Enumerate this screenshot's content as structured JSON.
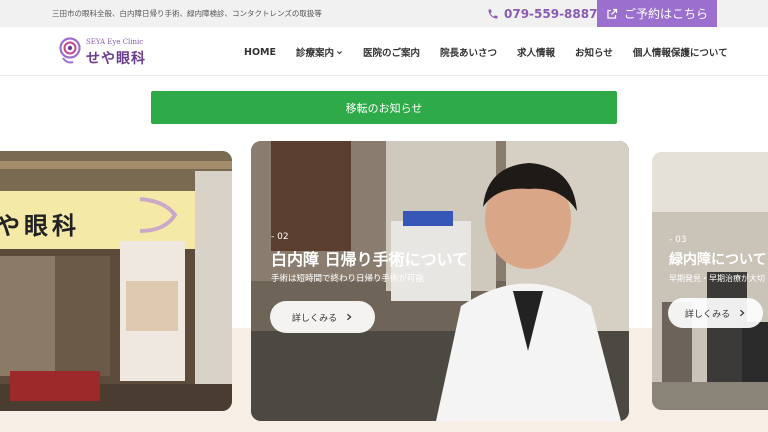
{
  "topbar": {
    "description": "三田市の眼科全般、白内障日帰り手術、緑内障検診、コンタクトレンズの取扱等",
    "phone": "079-559-8887",
    "reserve_label": "ご予約はこちら"
  },
  "logo": {
    "en": "SEYA Eye Clinic",
    "jp": "せや眼科"
  },
  "nav": {
    "items": [
      "HOME",
      "診療案内",
      "医院のご案内",
      "院長あいさつ",
      "求人情報",
      "お知らせ",
      "個人情報保護について"
    ]
  },
  "notice": {
    "label": "移転のお知らせ"
  },
  "slides": {
    "left": {
      "sign_text": "や眼科"
    },
    "center": {
      "number": "- 02",
      "title": "白内障 日帰り手術について",
      "subtitle": "手術は短時間で終わり日帰り手術が可能",
      "button": "詳しくみる"
    },
    "right": {
      "number": "- 03",
      "title": "緑内障について",
      "subtitle": "早期発見・早期治療が大切",
      "button": "詳しくみる"
    }
  },
  "colors": {
    "brand_purple": "#9b6fcd",
    "notice_green": "#2eaa49"
  }
}
